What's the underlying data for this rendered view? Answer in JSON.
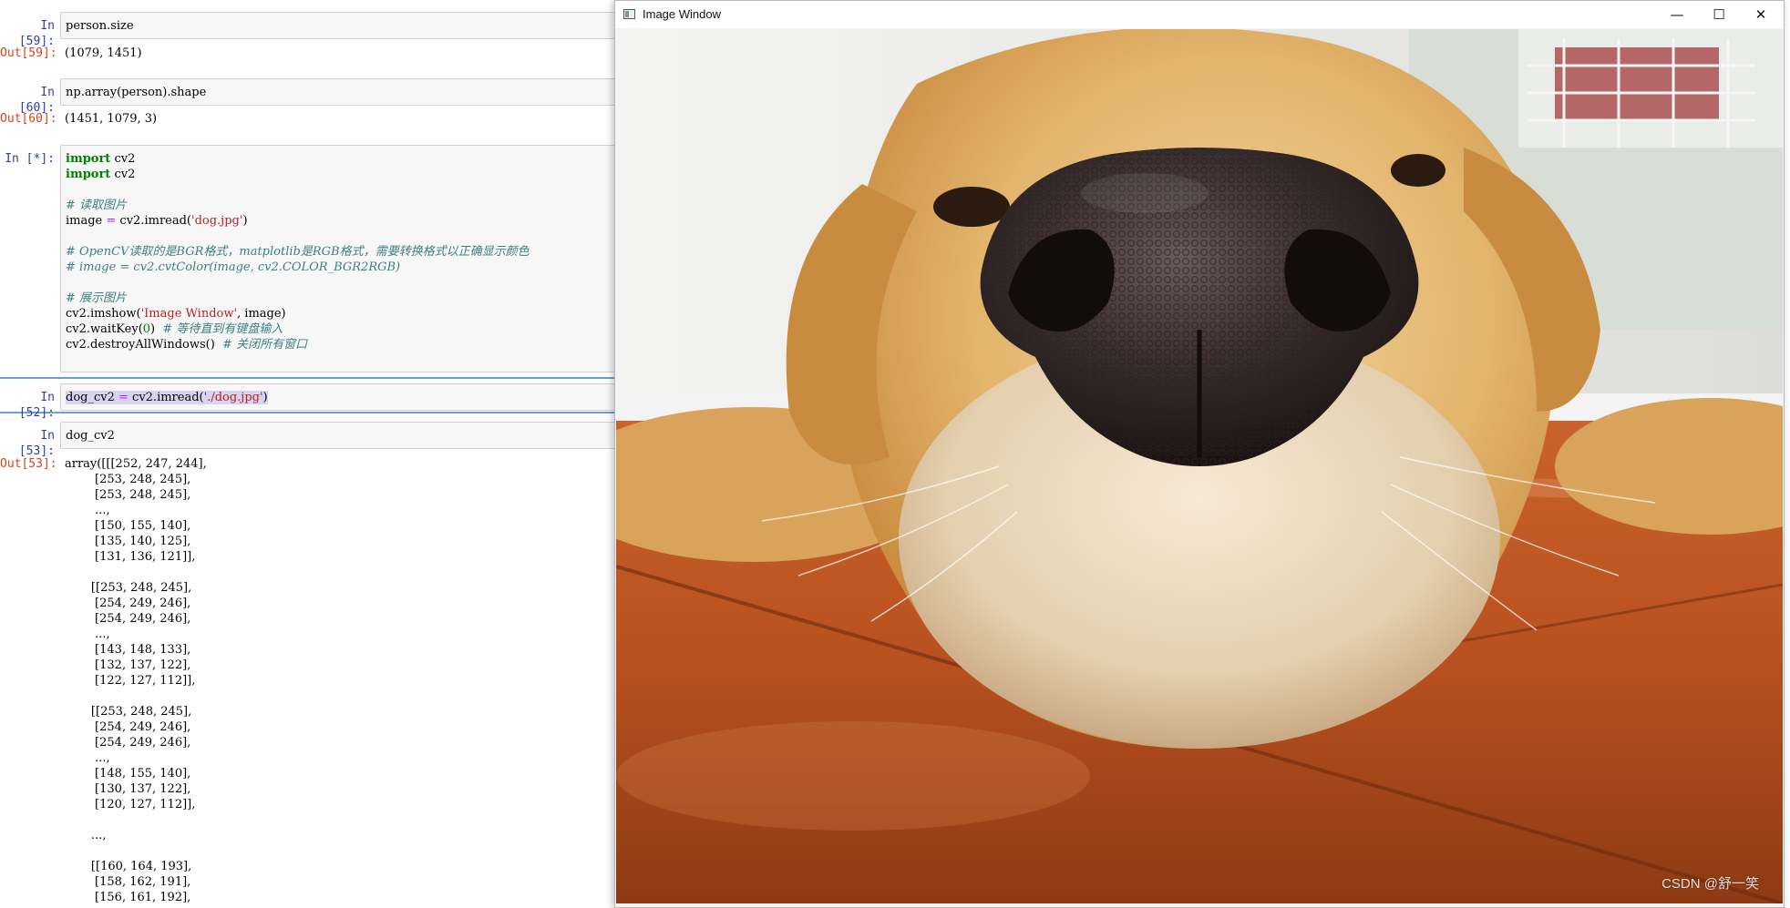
{
  "notebook": {
    "cells": [
      {
        "in_prompt": "In  [59]:",
        "code": "person.size",
        "out_prompt": "Out[59]:",
        "output": "(1079, 1451)"
      },
      {
        "in_prompt": "In  [60]:",
        "code": "np.array(person).shape",
        "out_prompt": "Out[60]:",
        "output": "(1451, 1079, 3)"
      },
      {
        "in_prompt": "In  [*]:"
      },
      {
        "in_prompt": "In  [52]:"
      },
      {
        "in_prompt": "In  [53]:",
        "code": "dog_cv2",
        "out_prompt": "Out[53]:"
      }
    ],
    "code_cell": {
      "l1_kw": "import",
      "l1_rest": " cv2",
      "l2_kw": "import",
      "l2_rest": " cv2",
      "l3_comment": "# 读取图片",
      "l4_a": "image ",
      "l4_op": "=",
      "l4_b": " cv2.imread(",
      "l4_str": "'dog.jpg'",
      "l4_c": ")",
      "l5_comment": "# OpenCV读取的是BGR格式，matplotlib是RGB格式，需要转换格式以正确显示颜色",
      "l6_comment": "# image = cv2.cvtColor(image, cv2.COLOR_BGR2RGB)",
      "l7_comment": "# 展示图片",
      "l8_a": "cv2.imshow(",
      "l8_str": "'Image Window'",
      "l8_b": ", image)",
      "l9_a": "cv2.waitKey(",
      "l9_num": "0",
      "l9_b": ")  ",
      "l9_comment": "# 等待直到有键盘输入",
      "l10_a": "cv2.destroyAllWindows()  ",
      "l10_comment": "# 关闭所有窗口"
    },
    "cell52": {
      "a": "dog_cv2 ",
      "op": "=",
      "b": " cv2.imread(",
      "str": "'./dog.jpg'",
      "c": ")"
    },
    "array_output": "array([[[252, 247, 244],\n        [253, 248, 245],\n        [253, 248, 245],\n        ...,\n        [150, 155, 140],\n        [135, 140, 125],\n        [131, 136, 121]],\n\n       [[253, 248, 245],\n        [254, 249, 246],\n        [254, 249, 246],\n        ...,\n        [143, 148, 133],\n        [132, 137, 122],\n        [122, 127, 112]],\n\n       [[253, 248, 245],\n        [254, 249, 246],\n        [254, 249, 246],\n        ...,\n        [148, 155, 140],\n        [130, 137, 122],\n        [120, 127, 112]],\n\n       ...,\n\n       [[160, 164, 193],\n        [158, 162, 191],\n        [156, 161, 192],"
  },
  "image_window": {
    "title": "Image Window",
    "minimize_glyph": "—",
    "maximize_glyph": "☐",
    "close_glyph": "✕",
    "image_subject": "golden retriever nose close-up on tiled floor",
    "watermark": "CSDN @舒一笑"
  },
  "colors": {
    "in_prompt": "#303f9f",
    "out_prompt": "#d84315",
    "keyword": "#008000",
    "string": "#ba2121",
    "comment": "#408080"
  }
}
